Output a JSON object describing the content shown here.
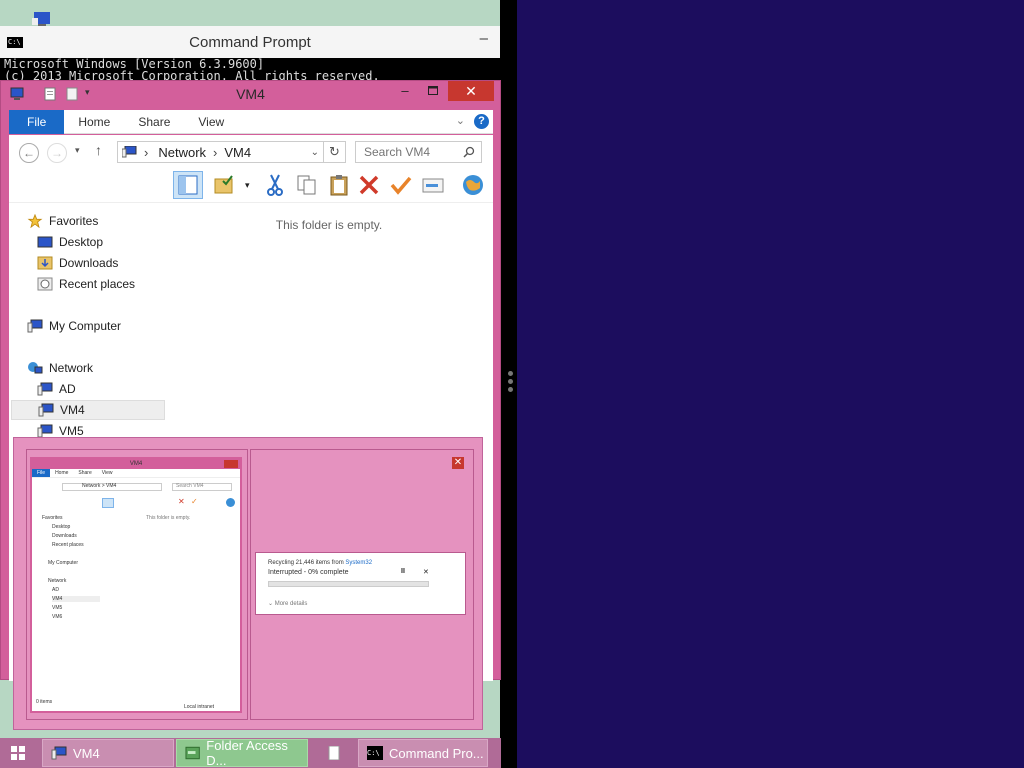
{
  "cmd": {
    "title": "Command Prompt",
    "line1": "Microsoft Windows [Version 6.3.9600]",
    "line2": "(c) 2013 Microsoft Corporation. All rights reserved."
  },
  "explorer": {
    "title": "VM4",
    "tabs": [
      "File",
      "Home",
      "Share",
      "View"
    ],
    "address": [
      "Network",
      "VM4"
    ],
    "search_placeholder": "Search VM4",
    "empty_message": "This folder is empty.",
    "nav": {
      "favorites": "Favorites",
      "desktop": "Desktop",
      "downloads": "Downloads",
      "recent": "Recent places",
      "my_computer": "My Computer",
      "network": "Network",
      "ad": "AD",
      "vm4": "VM4",
      "vm5": "VM5"
    }
  },
  "switcher": {
    "mini": {
      "title": "VM4",
      "tabs": [
        "File",
        "Home",
        "Share",
        "View"
      ],
      "address": "Network > VM4",
      "search": "Search VM4",
      "empty": "This folder is empty.",
      "nav": [
        "Favorites",
        "Desktop",
        "Downloads",
        "Recent places",
        "My Computer",
        "Network",
        "AD",
        "VM4",
        "VM5",
        "VM6"
      ],
      "status_left": "0 items",
      "status_right": "Local intranet"
    },
    "dialog": {
      "line1_prefix": "Recycling 21,446 items from ",
      "line1_link": "System32",
      "status": "Interrupted - 0% complete",
      "progress": 0,
      "more": "More details"
    }
  },
  "taskbar": {
    "items": [
      "VM4",
      "Folder Access D...",
      "",
      "Command Pro..."
    ]
  },
  "colors": {
    "window_frame": "#d35f9b",
    "accent": "#1a6ac7",
    "close": "#c7372f",
    "desktop": "#1c0d5e"
  }
}
